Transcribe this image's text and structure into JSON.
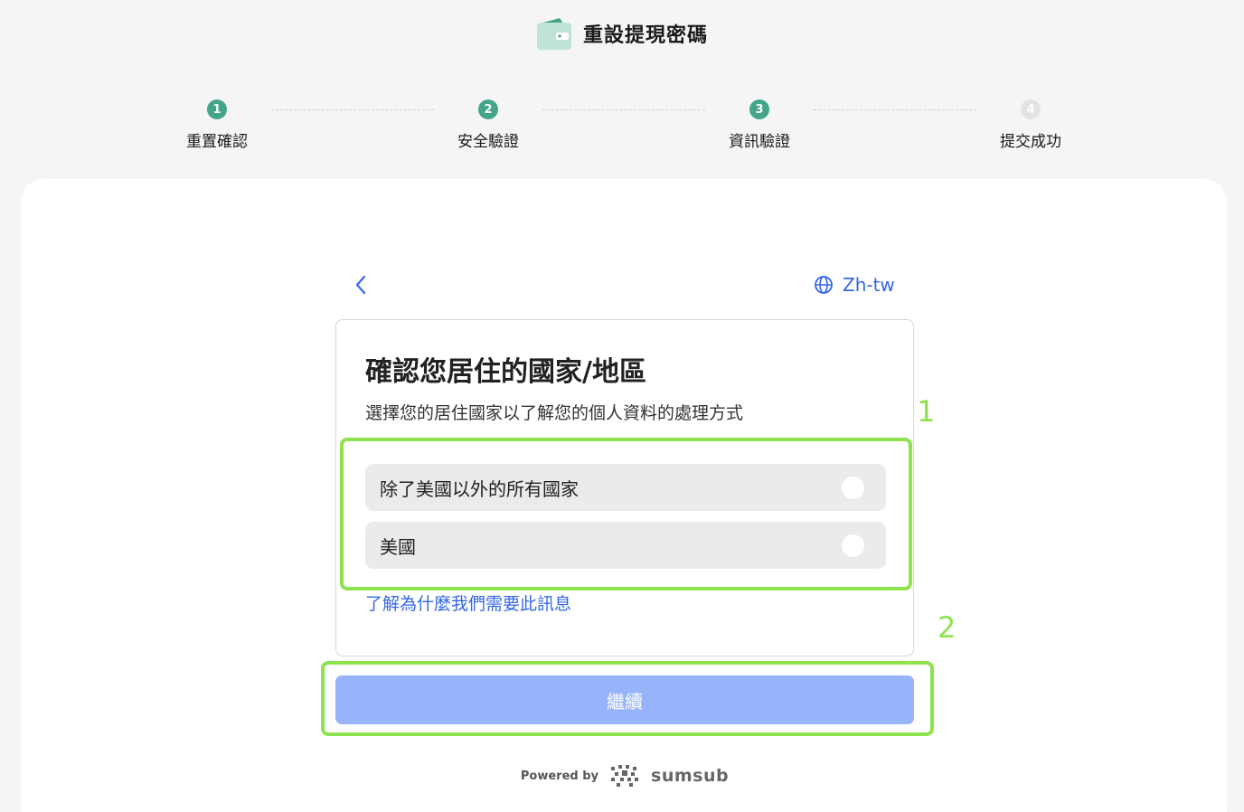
{
  "header": {
    "title": "重設提現密碼",
    "icon": "wallet-icon"
  },
  "stepper": {
    "steps": [
      {
        "number": "1",
        "label": "重置確認",
        "state": "done"
      },
      {
        "number": "2",
        "label": "安全驗證",
        "state": "done"
      },
      {
        "number": "3",
        "label": "資訊驗證",
        "state": "active"
      },
      {
        "number": "4",
        "label": "提交成功",
        "state": "pending"
      }
    ]
  },
  "nav": {
    "language": "Zh-tw",
    "back_icon": "chevron-left-icon",
    "language_icon": "globe-icon"
  },
  "form": {
    "title": "確認您居住的國家/地區",
    "subtitle": "選擇您的居住國家以了解您的個人資料的處理方式",
    "options": [
      {
        "label": "除了美國以外的所有國家",
        "selected": false
      },
      {
        "label": "美國",
        "selected": false
      }
    ],
    "learn_more": "了解為什麼我們需要此訊息",
    "continue_label": "繼續"
  },
  "annotations": {
    "box1": "1",
    "box2": "2",
    "color": "#8de24d"
  },
  "footer": {
    "powered_by": "Powered by",
    "brand": "sumsub"
  },
  "colors": {
    "accent_green": "#43a58a",
    "link_blue": "#3567e6",
    "button_disabled": "#97b3fa"
  }
}
